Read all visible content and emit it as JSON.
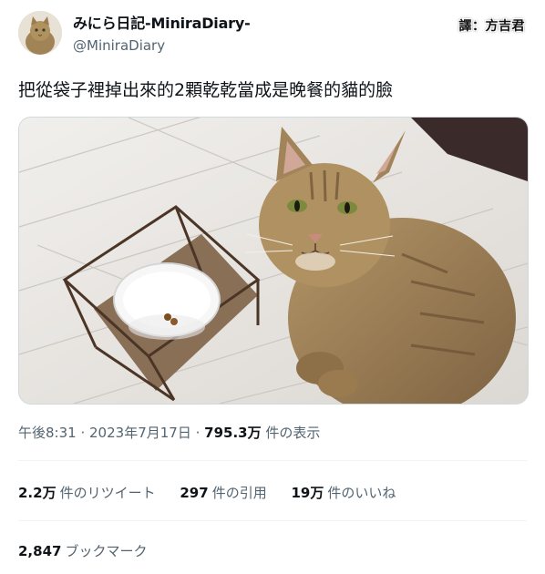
{
  "author": {
    "display_name": "みにら日記-MiniraDiary-",
    "handle": "@MiniraDiary"
  },
  "translator_credit": "譯：方吉君",
  "tweet": {
    "text": "把從袋子裡掉出來的2顆乾乾當成是晚餐的貓的臉"
  },
  "meta": {
    "time": "午後8:31",
    "date": "2023年7月17日",
    "views_count": "795.3万",
    "views_label": "件の表示"
  },
  "stats": {
    "retweets_count": "2.2万",
    "retweets_label": "件のリツイート",
    "quotes_count": "297",
    "quotes_label": "件の引用",
    "likes_count": "19万",
    "likes_label": "件のいいね"
  },
  "bookmarks": {
    "count": "2,847",
    "label": "ブックマーク"
  },
  "colors": {
    "text": "#0f1419",
    "secondary": "#536471",
    "divider": "#eff3f4"
  }
}
